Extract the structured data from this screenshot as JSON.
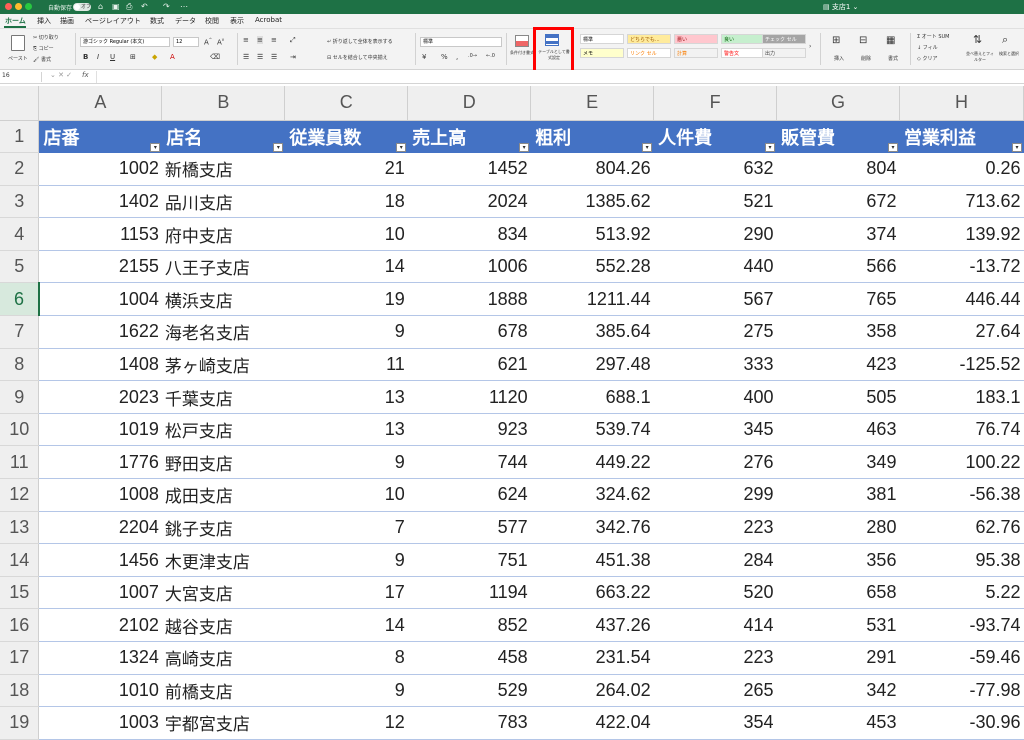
{
  "titlebar": {
    "autosave": "自動保存",
    "autosave_state": "オフ",
    "doc_title": "支店1"
  },
  "tabs": [
    "ホーム",
    "挿入",
    "描画",
    "ページレイアウト",
    "数式",
    "データ",
    "校閲",
    "表示",
    "Acrobat"
  ],
  "ribbon": {
    "paste": "ペースト",
    "cut": "切り取り",
    "copy": "コピー",
    "format_painter": "書式",
    "font_name": "游ゴシック Regular (本文)",
    "font_size": "12",
    "wrap_text": "折り返して全体を表示する",
    "merge_center": "セルを結合して中央揃え",
    "number_format": "標準",
    "conditional_format": "条件付き書式",
    "format_as_table": "テーブルとして書式設定",
    "styles": [
      "標準",
      "どちらでも...",
      "悪い",
      "良い",
      "チェック セル",
      "メモ",
      "リンク セル",
      "計算",
      "警告文",
      "出力"
    ],
    "insert": "挿入",
    "delete": "削除",
    "format": "書式",
    "autosum": "オート SUM",
    "fill": "フィル",
    "clear": "クリア",
    "sort_filter": "並べ替えとフィルター",
    "find_select": "検索と選択"
  },
  "formula_bar": {
    "name_box": "16",
    "fx": "fx",
    "value": ""
  },
  "columns": [
    "A",
    "B",
    "C",
    "D",
    "E",
    "F",
    "G",
    "H"
  ],
  "headers": [
    "店番",
    "店名",
    "従業員数",
    "売上高",
    "粗利",
    "人件費",
    "販管費",
    "営業利益"
  ],
  "rows": [
    [
      "1002",
      "新橋支店",
      "21",
      "1452",
      "804.26",
      "632",
      "804",
      "0.26"
    ],
    [
      "1402",
      "品川支店",
      "18",
      "2024",
      "1385.62",
      "521",
      "672",
      "713.62"
    ],
    [
      "1153",
      "府中支店",
      "10",
      "834",
      "513.92",
      "290",
      "374",
      "139.92"
    ],
    [
      "2155",
      "八王子支店",
      "14",
      "1006",
      "552.28",
      "440",
      "566",
      "-13.72"
    ],
    [
      "1004",
      "横浜支店",
      "19",
      "1888",
      "1211.44",
      "567",
      "765",
      "446.44"
    ],
    [
      "1622",
      "海老名支店",
      "9",
      "678",
      "385.64",
      "275",
      "358",
      "27.64"
    ],
    [
      "1408",
      "茅ヶ崎支店",
      "11",
      "621",
      "297.48",
      "333",
      "423",
      "-125.52"
    ],
    [
      "2023",
      "千葉支店",
      "13",
      "1120",
      "688.1",
      "400",
      "505",
      "183.1"
    ],
    [
      "1019",
      "松戸支店",
      "13",
      "923",
      "539.74",
      "345",
      "463",
      "76.74"
    ],
    [
      "1776",
      "野田支店",
      "9",
      "744",
      "449.22",
      "276",
      "349",
      "100.22"
    ],
    [
      "1008",
      "成田支店",
      "10",
      "624",
      "324.62",
      "299",
      "381",
      "-56.38"
    ],
    [
      "2204",
      "銚子支店",
      "7",
      "577",
      "342.76",
      "223",
      "280",
      "62.76"
    ],
    [
      "1456",
      "木更津支店",
      "9",
      "751",
      "451.38",
      "284",
      "356",
      "95.38"
    ],
    [
      "1007",
      "大宮支店",
      "17",
      "1194",
      "663.22",
      "520",
      "658",
      "5.22"
    ],
    [
      "2102",
      "越谷支店",
      "14",
      "852",
      "437.26",
      "414",
      "531",
      "-93.74"
    ],
    [
      "1324",
      "高崎支店",
      "8",
      "458",
      "231.54",
      "223",
      "291",
      "-59.46"
    ],
    [
      "1010",
      "前橋支店",
      "9",
      "529",
      "264.02",
      "265",
      "342",
      "-77.98"
    ],
    [
      "1003",
      "宇都宮支店",
      "12",
      "783",
      "422.04",
      "354",
      "453",
      "-30.96"
    ]
  ],
  "row_numbers": [
    "1",
    "2",
    "3",
    "4",
    "5",
    "6",
    "7",
    "8",
    "9",
    "10",
    "11",
    "12",
    "13",
    "14",
    "15",
    "16",
    "17",
    "18",
    "19"
  ],
  "selected_row": "6",
  "colors": {
    "excel_green": "#1e7145",
    "table_header": "#4472c4",
    "highlight": "#ff0000"
  }
}
